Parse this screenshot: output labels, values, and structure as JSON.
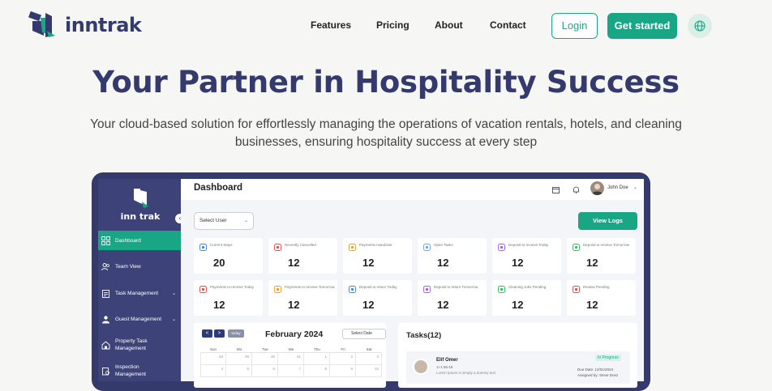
{
  "brand": {
    "name": "inntrak",
    "accent": "#19a685",
    "navy": "#353a6e"
  },
  "nav": {
    "links": [
      "Features",
      "Pricing",
      "About",
      "Contact"
    ],
    "login": "Login",
    "get_started": "Get started",
    "language_icon": "globe-icon"
  },
  "hero": {
    "title": "Your Partner in Hospitality Success",
    "subtitle": "Your cloud-based solution for effortlessly managing the operations of vacation rentals, hotels, and cleaning businesses, ensuring hospitality success at every step"
  },
  "dashboard": {
    "title": "Dashboard",
    "user_name": "John Doe",
    "sidebar_logo": "inn trak",
    "sidebar": [
      {
        "label": "Dashboard",
        "icon": "dashboard-icon",
        "active": true
      },
      {
        "label": "Team View",
        "icon": "team-icon"
      },
      {
        "label": "Task Management",
        "icon": "clipboard-icon",
        "expandable": true
      },
      {
        "label": "Guest Management",
        "icon": "guest-icon",
        "expandable": true
      },
      {
        "label": "Property Task Management",
        "icon": "property-icon"
      },
      {
        "label": "Inspection Management",
        "icon": "inspection-icon"
      }
    ],
    "select_user": "Select User",
    "view_logs": "View Logs",
    "stats": [
      {
        "label": "Current Stays",
        "value": "20",
        "color": "#3b82f6"
      },
      {
        "label": "Recently Cancelled",
        "value": "12",
        "color": "#ef4444"
      },
      {
        "label": "Payments Handover",
        "value": "12",
        "color": "#f59e0b"
      },
      {
        "label": "Open Tasks",
        "value": "12",
        "color": "#60a5fa"
      },
      {
        "label": "Deposit to receive Today",
        "value": "12",
        "color": "#a855f7"
      },
      {
        "label": "Deposit to receive Tomorrow",
        "value": "12",
        "color": "#22c55e"
      },
      {
        "label": "Payments to receive Today",
        "value": "12",
        "color": "#ef4444"
      },
      {
        "label": "Payments to receive Tomorrow",
        "value": "12",
        "color": "#f59e0b"
      },
      {
        "label": "Deposit to return Today",
        "value": "12",
        "color": "#3b82f6"
      },
      {
        "label": "Deposit to return Tomorrow",
        "value": "12",
        "color": "#a855f7"
      },
      {
        "label": "Cleaning Jobs Pending",
        "value": "12",
        "color": "#22c55e"
      },
      {
        "label": "Review Pending",
        "value": "12",
        "color": "#ef4444"
      }
    ],
    "calendar": {
      "prev": "<",
      "next": ">",
      "today": "today",
      "title": "February 2024",
      "select_date": "Select Date",
      "days": [
        "Sun",
        "Mo",
        "Tue",
        "We",
        "Thu",
        "Fri",
        "Sat"
      ],
      "first_row": [
        "28",
        "29",
        "30",
        "31",
        "1",
        "2",
        "3"
      ],
      "second_row": [
        "4",
        "5",
        "6",
        "7",
        "8",
        "9",
        "10"
      ]
    },
    "tasks": {
      "title": "Tasks(12)",
      "item": {
        "name": "Elif Omer",
        "meta": "1+1 55-18",
        "description": "Lorem Ipsum is simply a dummy text",
        "status": "In Progress",
        "due": "Due Date: 12/01/2024",
        "assigned": "Assigned by: Steve Doez"
      }
    }
  }
}
